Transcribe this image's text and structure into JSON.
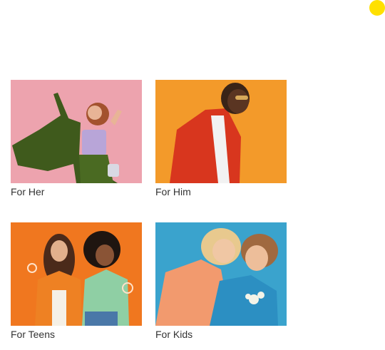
{
  "colors": {
    "accent_dot": "#FFE000",
    "her_bg": "#EDA3AE",
    "him_bg": "#F39A2A",
    "teens_bg": "#F0771F",
    "kids_bg": "#3AA3CD"
  },
  "categories": [
    {
      "id": "her",
      "label": "For Her",
      "image": "woman-dancing-green-suit-photo"
    },
    {
      "id": "him",
      "label": "For Him",
      "image": "man-laughing-red-jacket-photo"
    },
    {
      "id": "teens",
      "label": "For Teens",
      "image": "two-teens-blowing-bubbles-photo"
    },
    {
      "id": "kids",
      "label": "For Kids",
      "image": "two-kids-hugging-photo"
    }
  ]
}
